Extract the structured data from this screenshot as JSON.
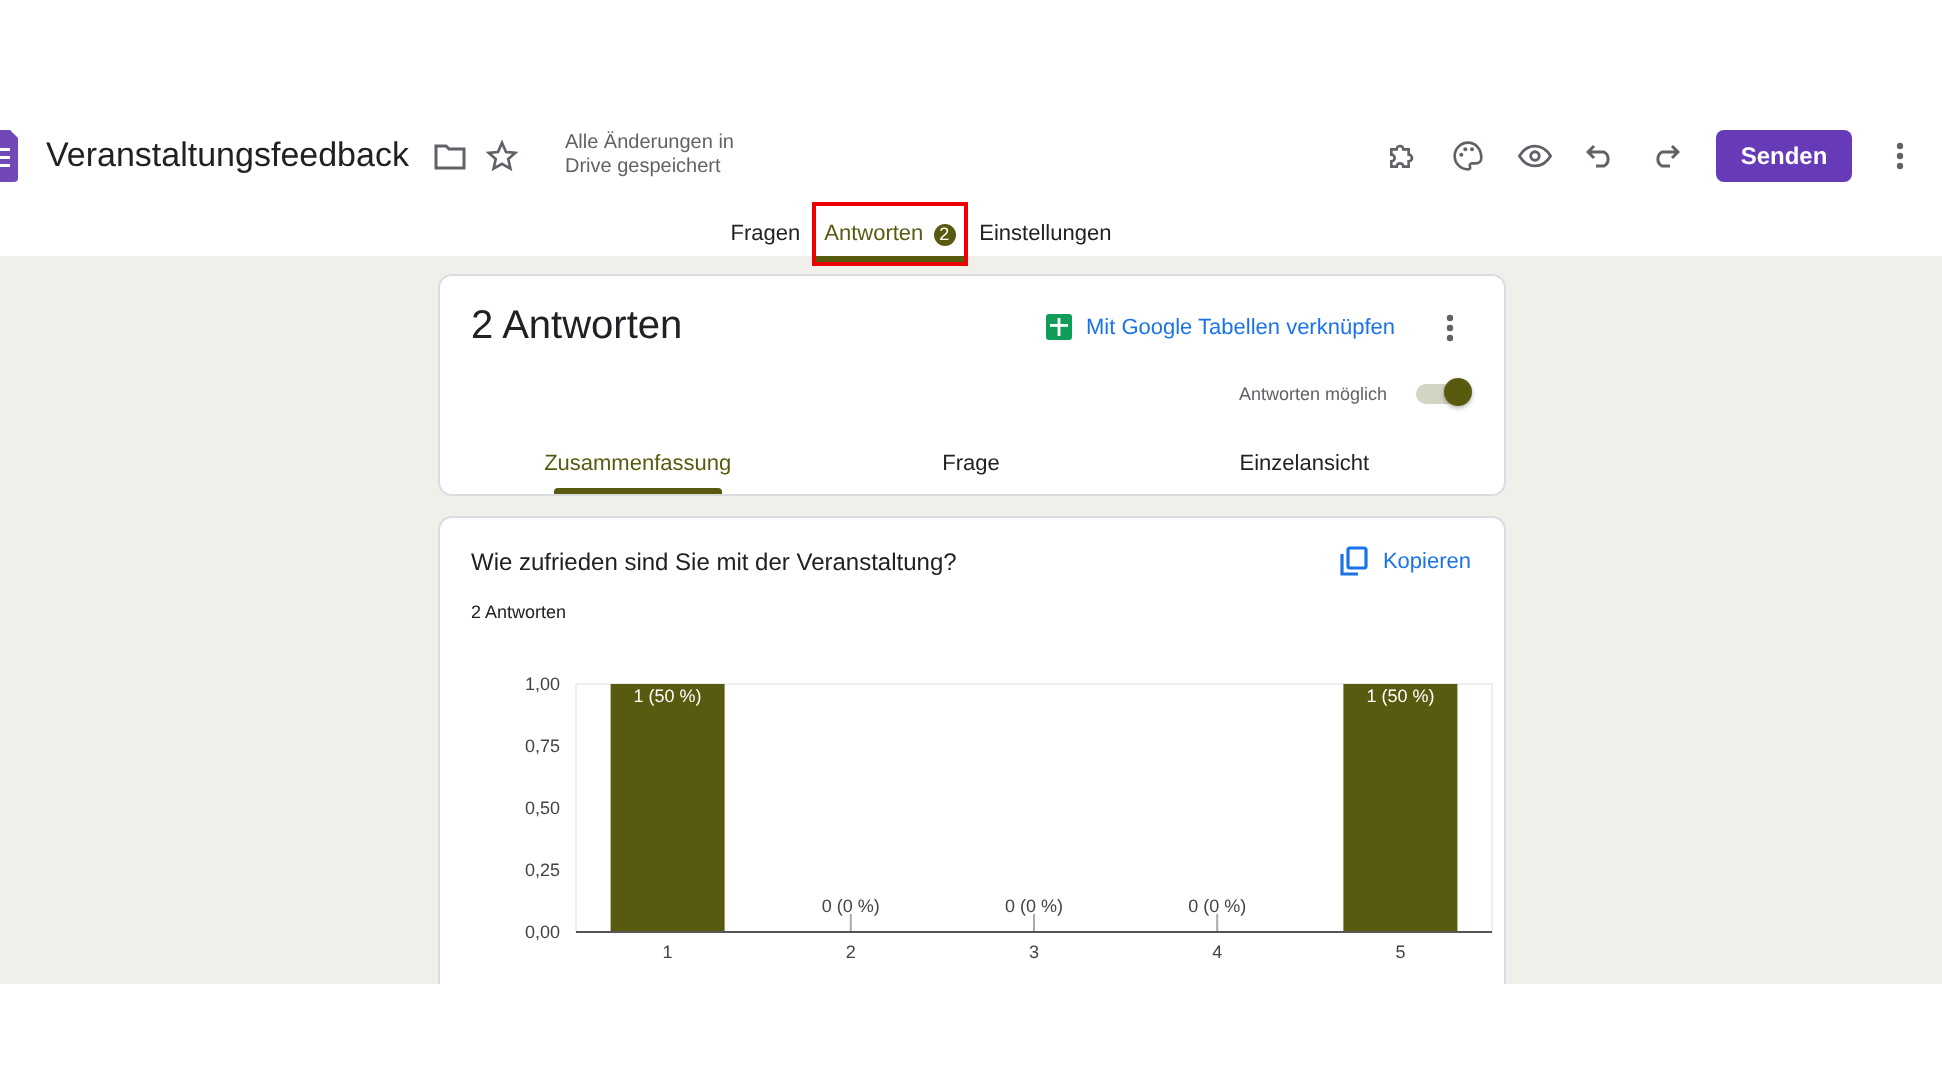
{
  "header": {
    "title": "Veranstaltungsfeedback",
    "save_status": "Alle Änderungen in Drive gespeichert",
    "send_button": "Senden"
  },
  "tabs": [
    {
      "label": "Fragen",
      "selected": false,
      "highlighted": false
    },
    {
      "label": "Antworten",
      "selected": true,
      "highlighted": true,
      "badge": "2"
    },
    {
      "label": "Einstellungen",
      "selected": false,
      "highlighted": false
    }
  ],
  "responses_card": {
    "title": "2 Antworten",
    "sheets_link": "Mit Google Tabellen verknüpfen",
    "accepting_label": "Antworten möglich",
    "accepting": true,
    "subtabs": [
      {
        "label": "Zusammenfassung",
        "selected": true
      },
      {
        "label": "Frage",
        "selected": false
      },
      {
        "label": "Einzelansicht",
        "selected": false
      }
    ]
  },
  "question_card": {
    "question": "Wie zufrieden sind Sie mit der Veranstaltung?",
    "count": "2 Antworten",
    "copy_button": "Kopieren",
    "chart_data": {
      "type": "bar",
      "categories": [
        "1",
        "2",
        "3",
        "4",
        "5"
      ],
      "series": [
        {
          "color": "#575a0f",
          "values": [
            1,
            0,
            0,
            0,
            1
          ]
        }
      ],
      "ylim": [
        0,
        1
      ],
      "yticks": [
        {
          "value": 0,
          "label": "0,00"
        },
        {
          "value": 0.25,
          "label": "0,25"
        },
        {
          "value": 0.5,
          "label": "0,50"
        },
        {
          "value": 0.75,
          "label": "0,75"
        },
        {
          "value": 1,
          "label": "1,00"
        }
      ],
      "value_labels": [
        "1 (50 %)",
        "0 (0 %)",
        "0 (0 %)",
        "0 (0 %)",
        "1 (50 %)"
      ]
    }
  }
}
